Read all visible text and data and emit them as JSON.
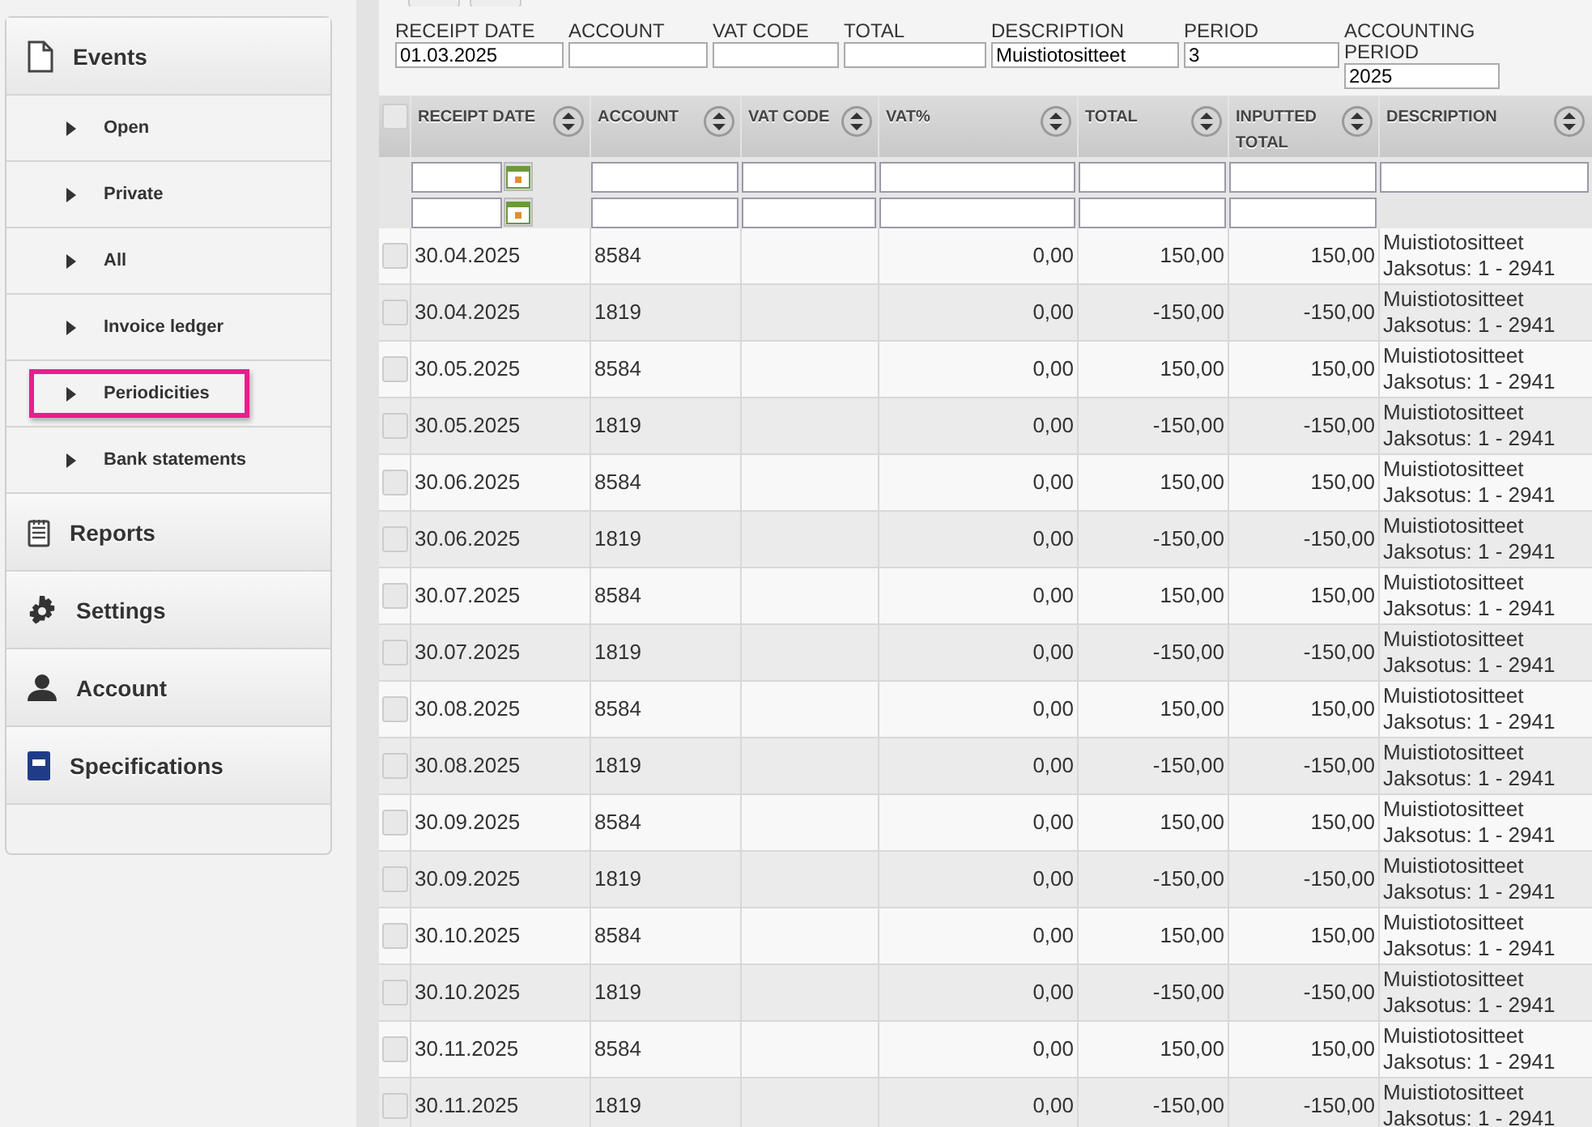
{
  "sidebar": {
    "sections": [
      {
        "label": "Events",
        "kind": "document",
        "items": [
          {
            "label": "Open",
            "selected": false
          },
          {
            "label": "Private",
            "selected": false
          },
          {
            "label": "All",
            "selected": false
          },
          {
            "label": "Invoice ledger",
            "selected": false
          },
          {
            "label": "Periodicities",
            "selected": true
          },
          {
            "label": "Bank statements",
            "selected": false
          }
        ]
      },
      {
        "label": "Reports",
        "kind": "notepad"
      },
      {
        "label": "Settings",
        "kind": "gear"
      },
      {
        "label": "Account",
        "kind": "person"
      },
      {
        "label": "Specifications",
        "kind": "book"
      }
    ]
  },
  "form": {
    "fields": [
      {
        "label": "RECEIPT DATE",
        "value": "01.03.2025"
      },
      {
        "label": "ACCOUNT"
      },
      {
        "label": "VAT CODE"
      },
      {
        "label": "TOTAL"
      },
      {
        "label": "DESCRIPTION",
        "value": "Muistiotositteet"
      },
      {
        "label": "PERIOD",
        "value": "3"
      },
      {
        "label": "ACCOUNTING PERIOD",
        "value": "2025"
      }
    ]
  },
  "table": {
    "all_checked": false,
    "columns": [
      "RECEIPT DATE",
      "ACCOUNT",
      "VAT CODE",
      "VAT%",
      "TOTAL",
      "INPUTTED TOTAL",
      "DESCRIPTION"
    ],
    "rows": [
      {
        "checked": false,
        "date": "30.04.2025",
        "account": "8584",
        "vat": "0,00",
        "total": "150,00",
        "inputted": "150,00",
        "description": [
          "Muistiotositteet",
          "Jaksotus: 1 - 2941"
        ]
      },
      {
        "checked": false,
        "date": "30.04.2025",
        "account": "1819",
        "vat": "0,00",
        "total": "-150,00",
        "inputted": "-150,00",
        "description": [
          "Muistiotositteet",
          "Jaksotus: 1 - 2941"
        ]
      },
      {
        "checked": false,
        "date": "30.05.2025",
        "account": "8584",
        "vat": "0,00",
        "total": "150,00",
        "inputted": "150,00",
        "description": [
          "Muistiotositteet",
          "Jaksotus: 1 - 2941"
        ]
      },
      {
        "checked": false,
        "date": "30.05.2025",
        "account": "1819",
        "vat": "0,00",
        "total": "-150,00",
        "inputted": "-150,00",
        "description": [
          "Muistiotositteet",
          "Jaksotus: 1 - 2941"
        ]
      },
      {
        "checked": false,
        "date": "30.06.2025",
        "account": "8584",
        "vat": "0,00",
        "total": "150,00",
        "inputted": "150,00",
        "description": [
          "Muistiotositteet",
          "Jaksotus: 1 - 2941"
        ]
      },
      {
        "checked": false,
        "date": "30.06.2025",
        "account": "1819",
        "vat": "0,00",
        "total": "-150,00",
        "inputted": "-150,00",
        "description": [
          "Muistiotositteet",
          "Jaksotus: 1 - 2941"
        ]
      },
      {
        "checked": false,
        "date": "30.07.2025",
        "account": "8584",
        "vat": "0,00",
        "total": "150,00",
        "inputted": "150,00",
        "description": [
          "Muistiotositteet",
          "Jaksotus: 1 - 2941"
        ]
      },
      {
        "checked": false,
        "date": "30.07.2025",
        "account": "1819",
        "vat": "0,00",
        "total": "-150,00",
        "inputted": "-150,00",
        "description": [
          "Muistiotositteet",
          "Jaksotus: 1 - 2941"
        ]
      },
      {
        "checked": false,
        "date": "30.08.2025",
        "account": "8584",
        "vat": "0,00",
        "total": "150,00",
        "inputted": "150,00",
        "description": [
          "Muistiotositteet",
          "Jaksotus: 1 - 2941"
        ]
      },
      {
        "checked": false,
        "date": "30.08.2025",
        "account": "1819",
        "vat": "0,00",
        "total": "-150,00",
        "inputted": "-150,00",
        "description": [
          "Muistiotositteet",
          "Jaksotus: 1 - 2941"
        ]
      },
      {
        "checked": false,
        "date": "30.09.2025",
        "account": "8584",
        "vat": "0,00",
        "total": "150,00",
        "inputted": "150,00",
        "description": [
          "Muistiotositteet",
          "Jaksotus: 1 - 2941"
        ]
      },
      {
        "checked": false,
        "date": "30.09.2025",
        "account": "1819",
        "vat": "0,00",
        "total": "-150,00",
        "inputted": "-150,00",
        "description": [
          "Muistiotositteet",
          "Jaksotus: 1 - 2941"
        ]
      },
      {
        "checked": false,
        "date": "30.10.2025",
        "account": "8584",
        "vat": "0,00",
        "total": "150,00",
        "inputted": "150,00",
        "description": [
          "Muistiotositteet",
          "Jaksotus: 1 - 2941"
        ]
      },
      {
        "checked": false,
        "date": "30.10.2025",
        "account": "1819",
        "vat": "0,00",
        "total": "-150,00",
        "inputted": "-150,00",
        "description": [
          "Muistiotositteet",
          "Jaksotus: 1 - 2941"
        ]
      },
      {
        "checked": false,
        "date": "30.11.2025",
        "account": "8584",
        "vat": "0,00",
        "total": "150,00",
        "inputted": "150,00",
        "description": [
          "Muistiotositteet",
          "Jaksotus: 1 - 2941"
        ]
      },
      {
        "checked": false,
        "date": "30.11.2025",
        "account": "1819",
        "vat": "0,00",
        "total": "-150,00",
        "inputted": "-150,00",
        "description": [
          "Muistiotositteet",
          "Jaksotus: 1 - 2941"
        ]
      }
    ]
  }
}
